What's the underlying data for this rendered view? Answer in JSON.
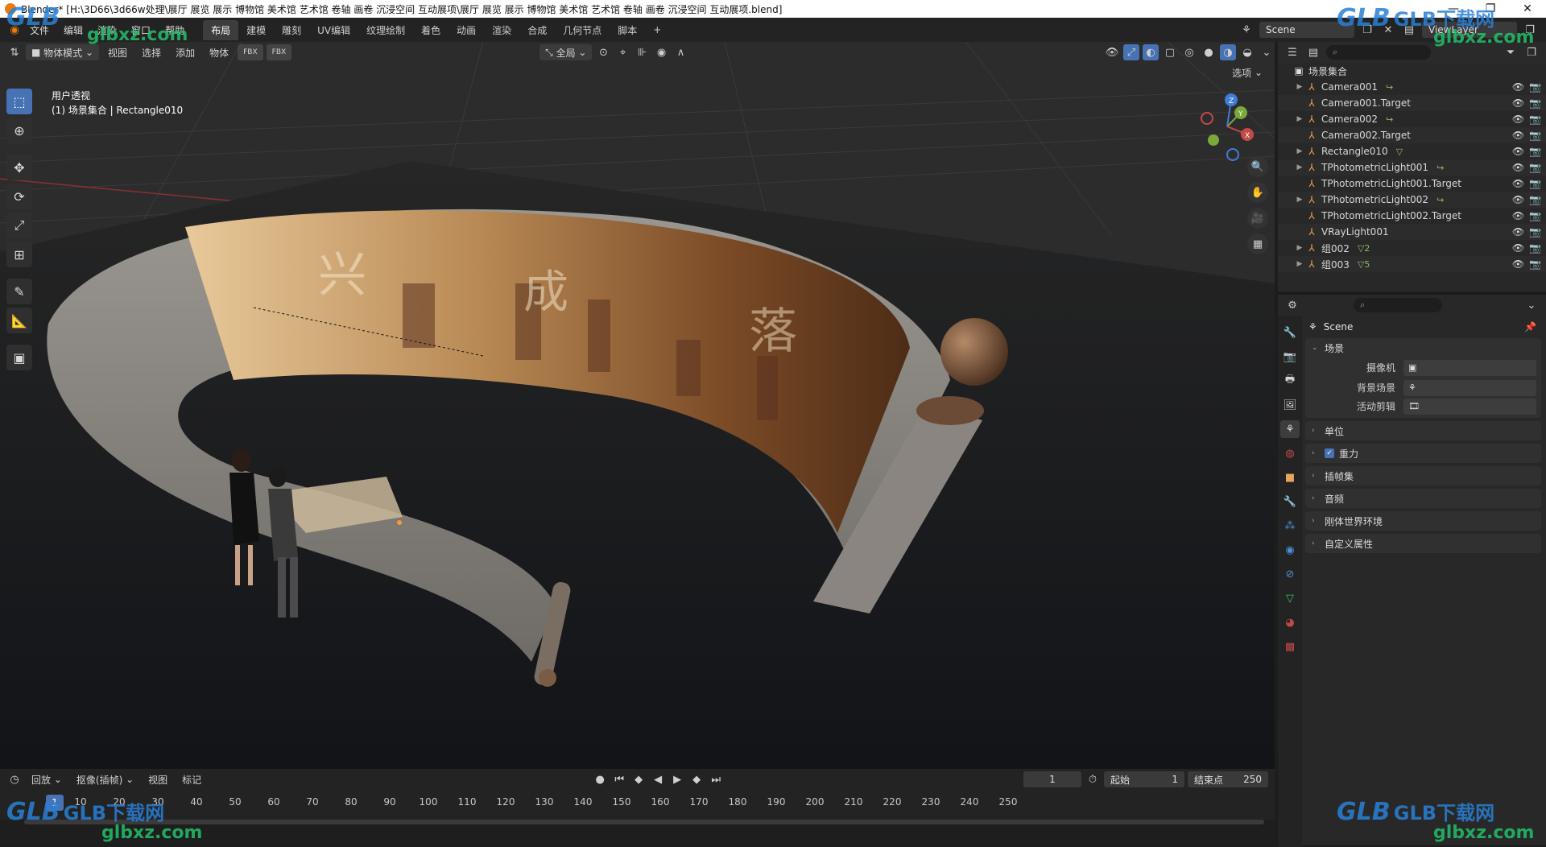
{
  "titlebar": {
    "title": "Blender* [H:\\3D66\\3d66w处理\\展厅 展览 展示 博物馆 美术馆 艺术馆 卷轴 画卷 沉浸空间 互动展项\\展厅 展览 展示 博物馆 美术馆 艺术馆 卷轴 画卷 沉浸空间 互动展项.blend]",
    "controls": [
      "—",
      "❐",
      "✕"
    ]
  },
  "menu": [
    "文件",
    "编辑",
    "渲染",
    "窗口",
    "帮助"
  ],
  "workspaces": [
    {
      "label": "布局",
      "active": true
    },
    {
      "label": "建模",
      "active": false
    },
    {
      "label": "雕刻",
      "active": false
    },
    {
      "label": "UV编辑",
      "active": false
    },
    {
      "label": "纹理绘制",
      "active": false
    },
    {
      "label": "着色",
      "active": false
    },
    {
      "label": "动画",
      "active": false
    },
    {
      "label": "渲染",
      "active": false
    },
    {
      "label": "合成",
      "active": false
    },
    {
      "label": "几何节点",
      "active": false
    },
    {
      "label": "脚本",
      "active": false
    }
  ],
  "add_workspace": "+",
  "scene_field": "Scene",
  "viewlayer_field": "ViewLayer",
  "viewport": {
    "mode": "物体模式",
    "menus": [
      "视图",
      "选择",
      "添加",
      "物体"
    ],
    "fbx_badges": [
      "FBX",
      "FBX"
    ],
    "transform_orientation": "全局",
    "options": "选项",
    "view_name": "用户透视",
    "object_info": "(1) 场景集合 | Rectangle010",
    "gizmo_axes": [
      "X",
      "Y",
      "Z"
    ]
  },
  "tools": [
    "select-box",
    "cursor",
    "move",
    "rotate",
    "scale",
    "transform",
    "annotate",
    "measure",
    "add-cube"
  ],
  "timeline": {
    "playback": "回放",
    "keying": "抠像(插帧)",
    "view": "视图",
    "marker": "标记",
    "current_frame": "1",
    "start_label": "起始",
    "start": "1",
    "end_label": "结束点",
    "end": "250",
    "cursor_frame": "1",
    "ticks": [
      "10",
      "20",
      "30",
      "40",
      "50",
      "60",
      "70",
      "80",
      "90",
      "100",
      "110",
      "120",
      "130",
      "140",
      "150",
      "160",
      "170",
      "180",
      "190",
      "200",
      "210",
      "220",
      "230",
      "240",
      "250"
    ]
  },
  "outliner": {
    "root": "场景集合",
    "items": [
      {
        "name": "Camera001",
        "expand": true,
        "extra": "↪"
      },
      {
        "name": "Camera001.Target",
        "expand": false,
        "extra": ""
      },
      {
        "name": "Camera002",
        "expand": true,
        "extra": "↪"
      },
      {
        "name": "Camera002.Target",
        "expand": false,
        "extra": ""
      },
      {
        "name": "Rectangle010",
        "expand": true,
        "extra": "▽"
      },
      {
        "name": "TPhotometricLight001",
        "expand": true,
        "extra": "↪"
      },
      {
        "name": "TPhotometricLight001.Target",
        "expand": false,
        "extra": ""
      },
      {
        "name": "TPhotometricLight002",
        "expand": true,
        "extra": "↪"
      },
      {
        "name": "TPhotometricLight002.Target",
        "expand": false,
        "extra": ""
      },
      {
        "name": "VRayLight001",
        "expand": false,
        "extra": ""
      },
      {
        "name": "组002",
        "expand": true,
        "extra": "▽2"
      },
      {
        "name": "组003",
        "expand": true,
        "extra": "▽5"
      }
    ]
  },
  "properties": {
    "context": "Scene",
    "scene_panel": "场景",
    "camera_label": "摄像机",
    "background_label": "背景场景",
    "active_clip_label": "活动剪辑",
    "panels": [
      "单位",
      "重力",
      "插帧集",
      "音频",
      "刚体世界环境",
      "自定义属性"
    ],
    "gravity_checked": "✓"
  },
  "watermarks": {
    "brand": "GLB下载网",
    "url": "glbxz.com",
    "logo": "GLB"
  }
}
